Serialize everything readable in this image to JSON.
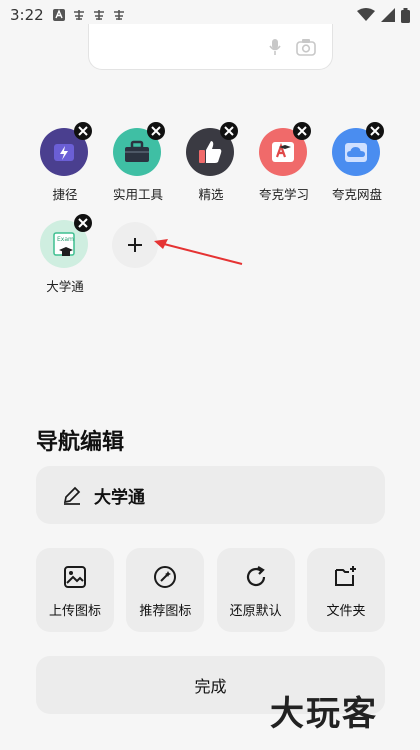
{
  "status_bar": {
    "time": "3:22"
  },
  "apps": [
    {
      "label": "捷径",
      "icon": "shortcut-icon",
      "color": "#4a3f8f"
    },
    {
      "label": "实用工具",
      "icon": "toolbox-icon",
      "color": "#3fbfa4"
    },
    {
      "label": "精选",
      "icon": "thumbs-up-icon",
      "color": "#3a3a42"
    },
    {
      "label": "夸克学习",
      "icon": "study-icon",
      "color": "#f06a6a"
    },
    {
      "label": "夸克网盘",
      "icon": "cloud-drive-icon",
      "color": "#4a8df0"
    },
    {
      "label": "大学通",
      "icon": "graduation-cap-icon",
      "color": "#cfeee0"
    }
  ],
  "section": {
    "title": "导航编辑"
  },
  "name_field": {
    "value": "大学通"
  },
  "actions": [
    {
      "label": "上传图标",
      "icon": "image-upload-icon"
    },
    {
      "label": "推荐图标",
      "icon": "magic-wand-icon"
    },
    {
      "label": "还原默认",
      "icon": "refresh-icon"
    },
    {
      "label": "文件夹",
      "icon": "folder-add-icon"
    }
  ],
  "done_label": "完成",
  "watermark": "大玩客"
}
